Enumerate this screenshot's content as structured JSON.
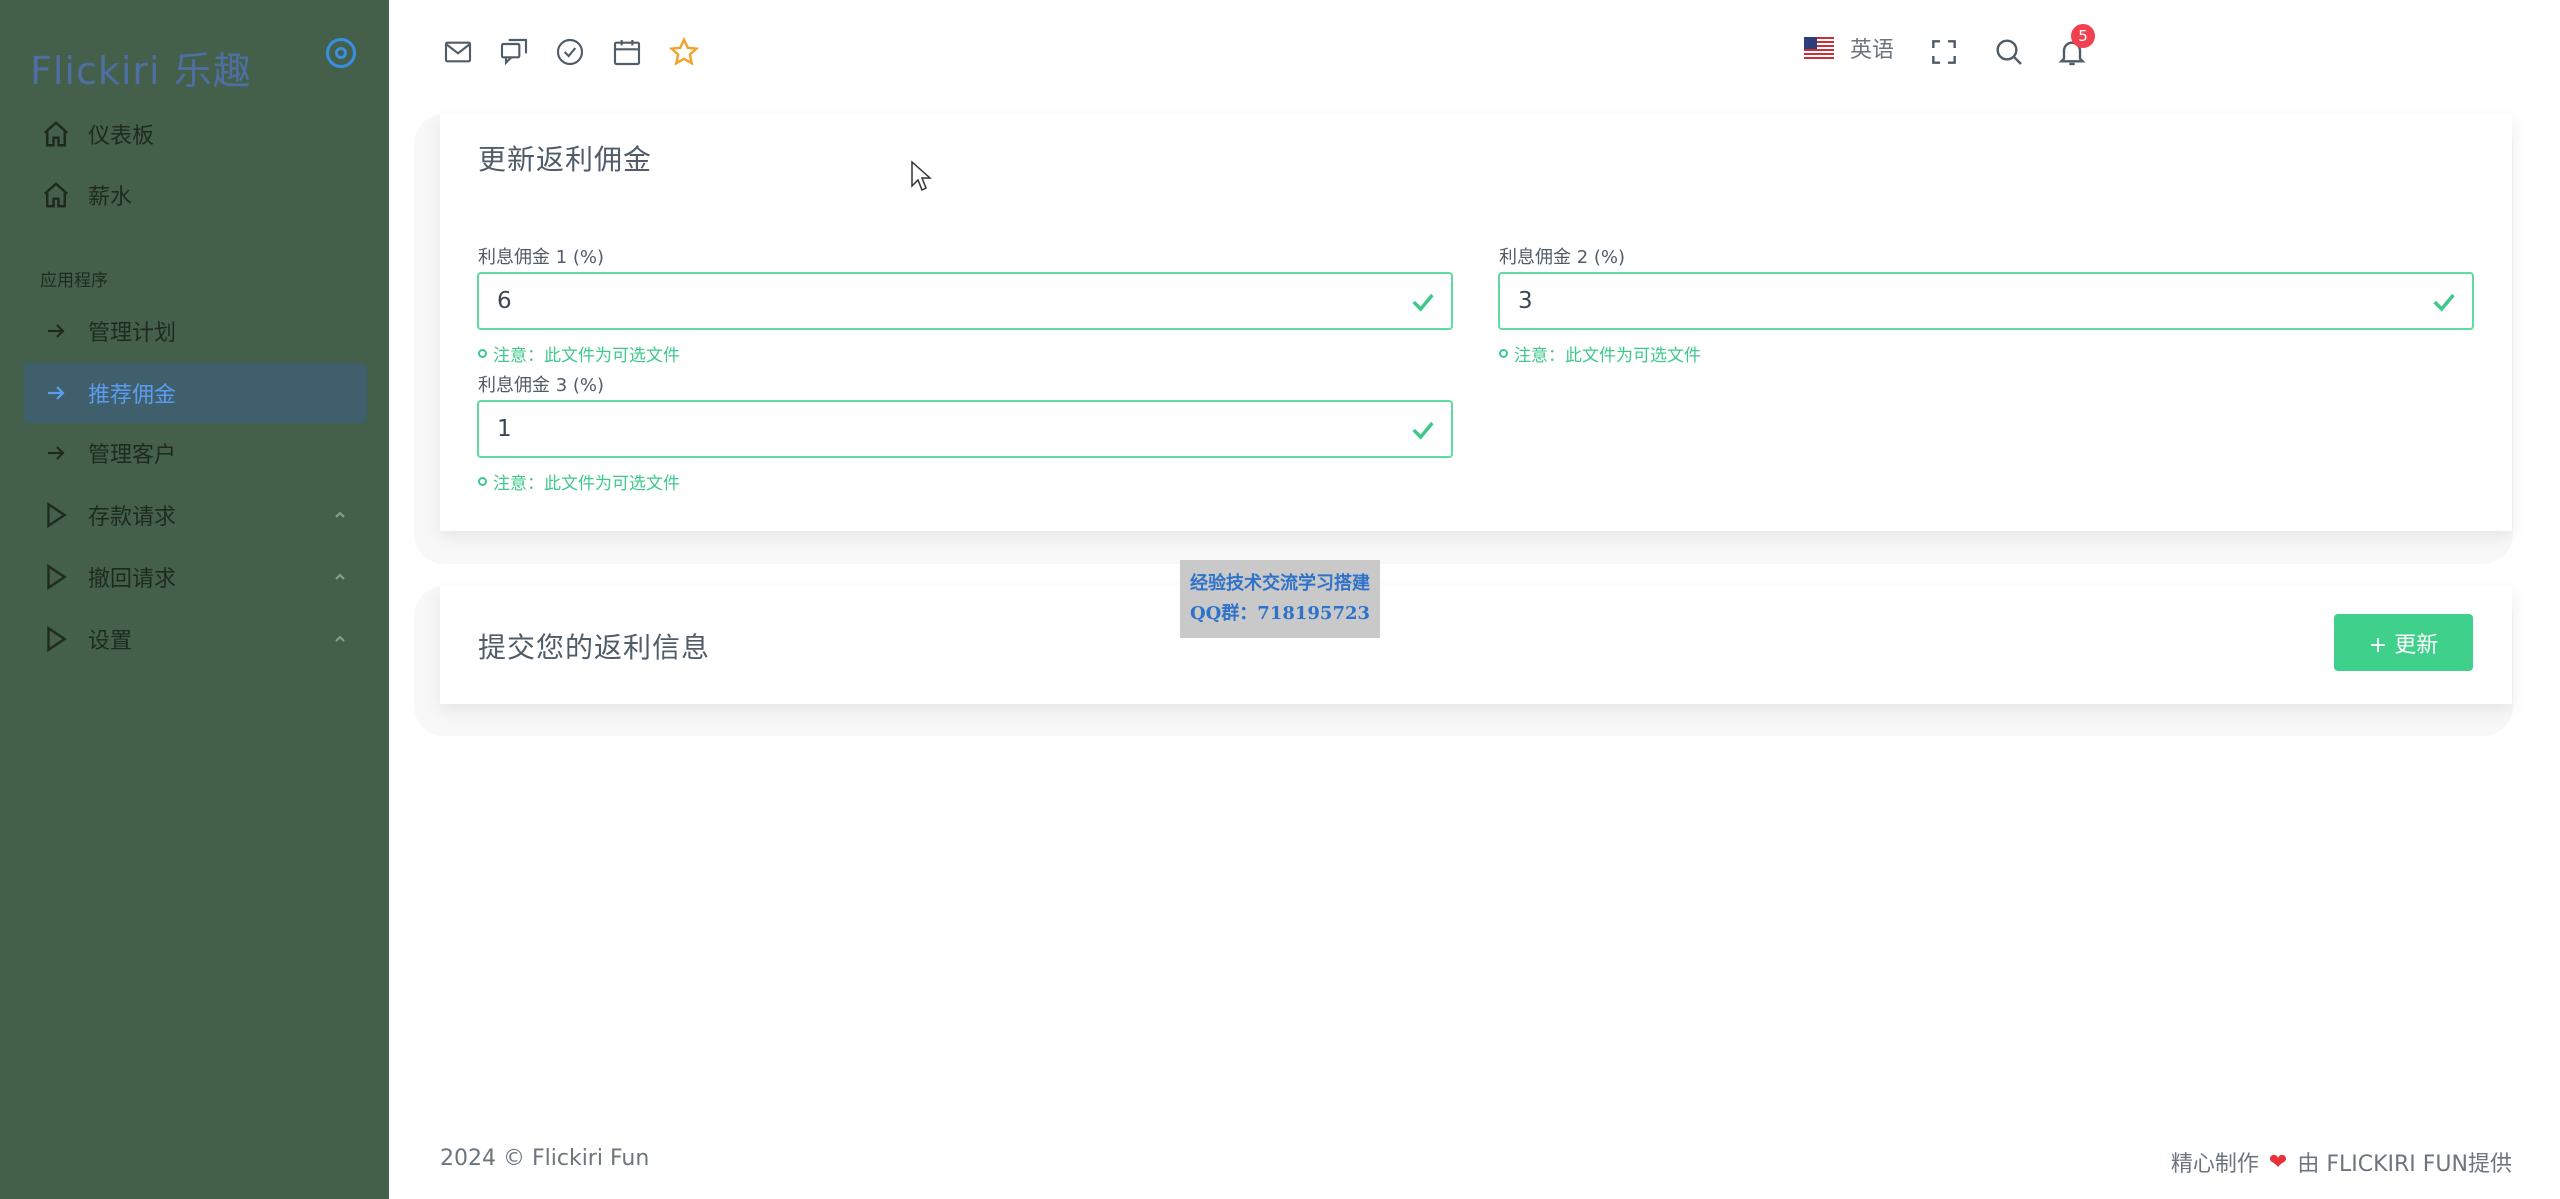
{
  "sidebar": {
    "brand": "Flickiri 乐趣",
    "items": [
      {
        "label": "仪表板",
        "icon": "home-icon"
      },
      {
        "label": "薪水",
        "icon": "home-icon"
      }
    ],
    "section_title": "应用程序",
    "app_items": [
      {
        "label": "管理计划",
        "icon": "arrow-right-icon"
      },
      {
        "label": "推荐佣金",
        "icon": "arrow-right-icon",
        "active": true
      },
      {
        "label": "管理客户",
        "icon": "arrow-right-icon"
      },
      {
        "label": "存款请求",
        "icon": "play-icon",
        "expandable": true
      },
      {
        "label": "撤回请求",
        "icon": "play-icon",
        "expandable": true
      },
      {
        "label": "设置",
        "icon": "play-icon",
        "expandable": true
      }
    ]
  },
  "topbar": {
    "icons": [
      "mail-icon",
      "chat-icon",
      "check-circle-icon",
      "calendar-icon",
      "star-icon"
    ],
    "language": "英语",
    "notification_count": "5"
  },
  "form_card": {
    "title": "更新返利佣金",
    "fields": [
      {
        "label": "利息佣金 1 (%)",
        "value": "6",
        "hint": "注意：此文件为可选文件"
      },
      {
        "label": "利息佣金 2 (%)",
        "value": "3",
        "hint": "注意：此文件为可选文件"
      },
      {
        "label": "利息佣金 3 (%)",
        "value": "1",
        "hint": "注意：此文件为可选文件"
      }
    ]
  },
  "submit_card": {
    "title": "提交您的返利信息",
    "button_label": "+ 更新"
  },
  "watermark": {
    "line1": "经验技术交流学习搭建",
    "line2": "QQ群：718195723"
  },
  "footer": {
    "left": "2024 © Flickiri Fun",
    "right_prefix": "精心制作",
    "right_suffix": "由 FLICKIRI FUN提供"
  },
  "colors": {
    "sidebar_bg": "#44604a",
    "accent": "#3fd08b",
    "active_item_bg": "#3e5f6b",
    "badge": "#f1414f"
  }
}
